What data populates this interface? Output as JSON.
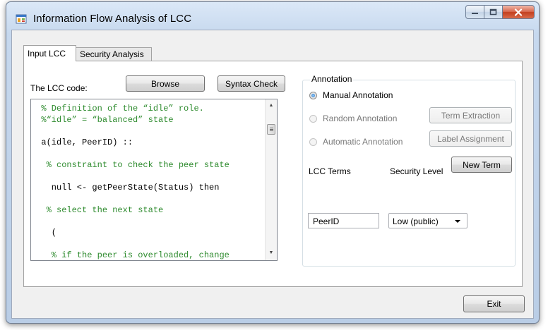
{
  "window": {
    "title": "Information Flow Analysis of LCC"
  },
  "tabs": [
    {
      "label": "Input LCC"
    },
    {
      "label": "Security Analysis"
    }
  ],
  "lcc_code": {
    "label": "The LCC code:",
    "browse_label": "Browse",
    "syntax_check_label": "Syntax Check",
    "lines": [
      "  % Definition of the “idle” role.",
      "  %“idle” = “balanced” state",
      "",
      "  a(idle, PeerID) ::",
      "",
      "   % constraint to check the peer state",
      "",
      "    null <- getPeerState(Status) then",
      "",
      "   % select the next state",
      "",
      "    (",
      "",
      "    % if the peer is overloaded, change"
    ]
  },
  "annotation": {
    "group_label": "Annotation",
    "options": [
      {
        "label": "Manual Annotation",
        "selected": true,
        "enabled": true
      },
      {
        "label": "Random Annotation",
        "selected": false,
        "enabled": false
      },
      {
        "label": "Automatic Annotation",
        "selected": false,
        "enabled": false
      }
    ],
    "term_extraction_label": "Term Extraction",
    "label_assignment_label": "Label Assignment",
    "new_term_label": "New Term",
    "lcc_terms_label": "LCC Terms",
    "security_level_label": "Security Level",
    "term_value": "PeerID",
    "security_level_value": "Low (public)"
  },
  "footer": {
    "exit_label": "Exit"
  },
  "colors": {
    "comment": "#2e8b2e",
    "close_button": "#c3401f"
  }
}
